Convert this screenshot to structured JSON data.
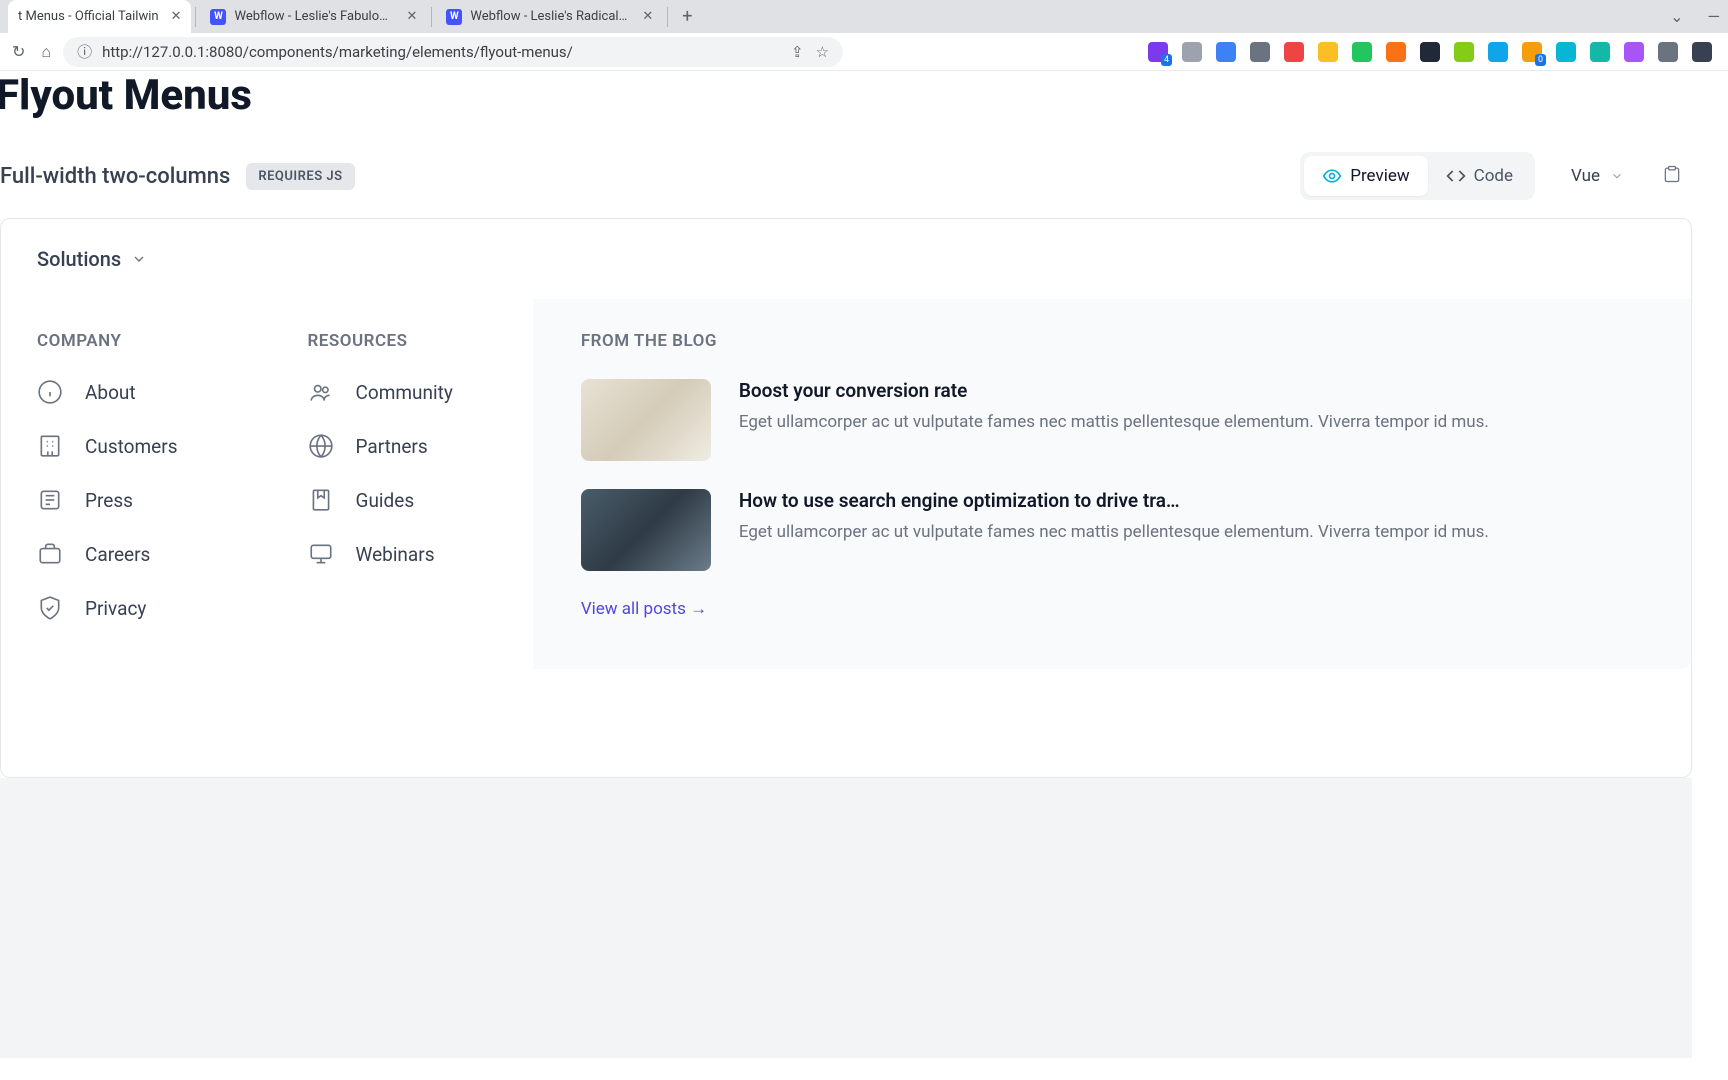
{
  "browser": {
    "tabs": [
      {
        "title": "t Menus - Official Tailwin",
        "active": true,
        "favicon_bg": "transparent"
      },
      {
        "title": "Webflow - Leslie's Fabulous Si",
        "active": false,
        "favicon_bg": "#4353ff",
        "favicon_text": "W"
      },
      {
        "title": "Webflow - Leslie's Radical Site",
        "active": false,
        "favicon_bg": "#4353ff",
        "favicon_text": "W"
      }
    ],
    "url": "http://127.0.0.1:8080/components/marketing/elements/flyout-menus/",
    "extensions": [
      {
        "bg": "#7c3aed",
        "badge": "4"
      },
      {
        "bg": "#9ca3af"
      },
      {
        "bg": "#3b82f6"
      },
      {
        "bg": "#6b7280"
      },
      {
        "bg": "#ef4444"
      },
      {
        "bg": "#fbbf24"
      },
      {
        "bg": "#22c55e"
      },
      {
        "bg": "#f97316"
      },
      {
        "bg": "#1f2937"
      },
      {
        "bg": "#84cc16"
      },
      {
        "bg": "#0ea5e9"
      },
      {
        "bg": "#f59e0b",
        "badge": "0"
      },
      {
        "bg": "#06b6d4"
      },
      {
        "bg": "#14b8a6"
      },
      {
        "bg": "#a855f7"
      },
      {
        "bg": "#6b7280"
      },
      {
        "bg": "#374151"
      }
    ]
  },
  "page": {
    "heading": "Flyout Menus",
    "section_label": "Full-width two-columns",
    "badge": "REQUIRES JS",
    "preview_label": "Preview",
    "code_label": "Code",
    "framework": "Vue",
    "trigger": "Solutions"
  },
  "company": {
    "title": "COMPANY",
    "items": [
      {
        "label": "About",
        "icon": "info"
      },
      {
        "label": "Customers",
        "icon": "building"
      },
      {
        "label": "Press",
        "icon": "newspaper"
      },
      {
        "label": "Careers",
        "icon": "briefcase"
      },
      {
        "label": "Privacy",
        "icon": "shield"
      }
    ]
  },
  "resources": {
    "title": "RESOURCES",
    "items": [
      {
        "label": "Community",
        "icon": "users"
      },
      {
        "label": "Partners",
        "icon": "globe"
      },
      {
        "label": "Guides",
        "icon": "bookmark"
      },
      {
        "label": "Webinars",
        "icon": "monitor"
      }
    ]
  },
  "blog": {
    "title": "FROM THE BLOG",
    "items": [
      {
        "title": "Boost your conversion rate",
        "desc": "Eget ullamcorper ac ut vulputate fames nec mattis pellentesque elementum. Viverra tempor id mus."
      },
      {
        "title": "How to use search engine optimization to drive tra…",
        "desc": "Eget ullamcorper ac ut vulputate fames nec mattis pellentesque elementum. Viverra tempor id mus."
      }
    ],
    "view_all": "View all posts →"
  }
}
